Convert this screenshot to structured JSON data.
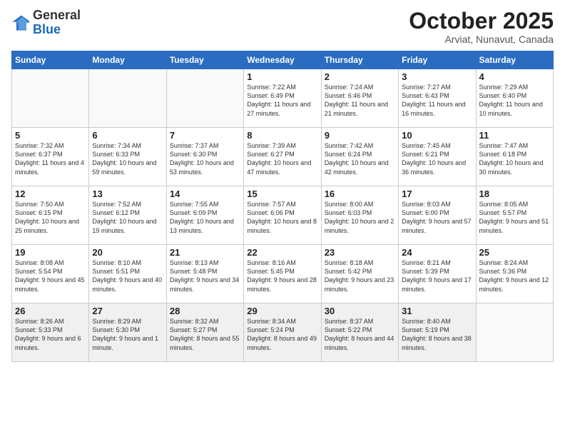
{
  "header": {
    "logo_general": "General",
    "logo_blue": "Blue",
    "title": "October 2025",
    "subtitle": "Arviat, Nunavut, Canada"
  },
  "days_of_week": [
    "Sunday",
    "Monday",
    "Tuesday",
    "Wednesday",
    "Thursday",
    "Friday",
    "Saturday"
  ],
  "weeks": [
    [
      {
        "day": "",
        "info": ""
      },
      {
        "day": "",
        "info": ""
      },
      {
        "day": "",
        "info": ""
      },
      {
        "day": "1",
        "info": "Sunrise: 7:22 AM\nSunset: 6:49 PM\nDaylight: 11 hours\nand 27 minutes."
      },
      {
        "day": "2",
        "info": "Sunrise: 7:24 AM\nSunset: 6:46 PM\nDaylight: 11 hours\nand 21 minutes."
      },
      {
        "day": "3",
        "info": "Sunrise: 7:27 AM\nSunset: 6:43 PM\nDaylight: 11 hours\nand 16 minutes."
      },
      {
        "day": "4",
        "info": "Sunrise: 7:29 AM\nSunset: 6:40 PM\nDaylight: 11 hours\nand 10 minutes."
      }
    ],
    [
      {
        "day": "5",
        "info": "Sunrise: 7:32 AM\nSunset: 6:37 PM\nDaylight: 11 hours\nand 4 minutes."
      },
      {
        "day": "6",
        "info": "Sunrise: 7:34 AM\nSunset: 6:33 PM\nDaylight: 10 hours\nand 59 minutes."
      },
      {
        "day": "7",
        "info": "Sunrise: 7:37 AM\nSunset: 6:30 PM\nDaylight: 10 hours\nand 53 minutes."
      },
      {
        "day": "8",
        "info": "Sunrise: 7:39 AM\nSunset: 6:27 PM\nDaylight: 10 hours\nand 47 minutes."
      },
      {
        "day": "9",
        "info": "Sunrise: 7:42 AM\nSunset: 6:24 PM\nDaylight: 10 hours\nand 42 minutes."
      },
      {
        "day": "10",
        "info": "Sunrise: 7:45 AM\nSunset: 6:21 PM\nDaylight: 10 hours\nand 36 minutes."
      },
      {
        "day": "11",
        "info": "Sunrise: 7:47 AM\nSunset: 6:18 PM\nDaylight: 10 hours\nand 30 minutes."
      }
    ],
    [
      {
        "day": "12",
        "info": "Sunrise: 7:50 AM\nSunset: 6:15 PM\nDaylight: 10 hours\nand 25 minutes."
      },
      {
        "day": "13",
        "info": "Sunrise: 7:52 AM\nSunset: 6:12 PM\nDaylight: 10 hours\nand 19 minutes."
      },
      {
        "day": "14",
        "info": "Sunrise: 7:55 AM\nSunset: 6:09 PM\nDaylight: 10 hours\nand 13 minutes."
      },
      {
        "day": "15",
        "info": "Sunrise: 7:57 AM\nSunset: 6:06 PM\nDaylight: 10 hours\nand 8 minutes."
      },
      {
        "day": "16",
        "info": "Sunrise: 8:00 AM\nSunset: 6:03 PM\nDaylight: 10 hours\nand 2 minutes."
      },
      {
        "day": "17",
        "info": "Sunrise: 8:03 AM\nSunset: 6:00 PM\nDaylight: 9 hours\nand 57 minutes."
      },
      {
        "day": "18",
        "info": "Sunrise: 8:05 AM\nSunset: 5:57 PM\nDaylight: 9 hours\nand 51 minutes."
      }
    ],
    [
      {
        "day": "19",
        "info": "Sunrise: 8:08 AM\nSunset: 5:54 PM\nDaylight: 9 hours\nand 45 minutes."
      },
      {
        "day": "20",
        "info": "Sunrise: 8:10 AM\nSunset: 5:51 PM\nDaylight: 9 hours\nand 40 minutes."
      },
      {
        "day": "21",
        "info": "Sunrise: 8:13 AM\nSunset: 5:48 PM\nDaylight: 9 hours\nand 34 minutes."
      },
      {
        "day": "22",
        "info": "Sunrise: 8:16 AM\nSunset: 5:45 PM\nDaylight: 9 hours\nand 28 minutes."
      },
      {
        "day": "23",
        "info": "Sunrise: 8:18 AM\nSunset: 5:42 PM\nDaylight: 9 hours\nand 23 minutes."
      },
      {
        "day": "24",
        "info": "Sunrise: 8:21 AM\nSunset: 5:39 PM\nDaylight: 9 hours\nand 17 minutes."
      },
      {
        "day": "25",
        "info": "Sunrise: 8:24 AM\nSunset: 5:36 PM\nDaylight: 9 hours\nand 12 minutes."
      }
    ],
    [
      {
        "day": "26",
        "info": "Sunrise: 8:26 AM\nSunset: 5:33 PM\nDaylight: 9 hours\nand 6 minutes."
      },
      {
        "day": "27",
        "info": "Sunrise: 8:29 AM\nSunset: 5:30 PM\nDaylight: 9 hours\nand 1 minute."
      },
      {
        "day": "28",
        "info": "Sunrise: 8:32 AM\nSunset: 5:27 PM\nDaylight: 8 hours\nand 55 minutes."
      },
      {
        "day": "29",
        "info": "Sunrise: 8:34 AM\nSunset: 5:24 PM\nDaylight: 8 hours\nand 49 minutes."
      },
      {
        "day": "30",
        "info": "Sunrise: 8:37 AM\nSunset: 5:22 PM\nDaylight: 8 hours\nand 44 minutes."
      },
      {
        "day": "31",
        "info": "Sunrise: 8:40 AM\nSunset: 5:19 PM\nDaylight: 8 hours\nand 38 minutes."
      },
      {
        "day": "",
        "info": ""
      }
    ]
  ]
}
